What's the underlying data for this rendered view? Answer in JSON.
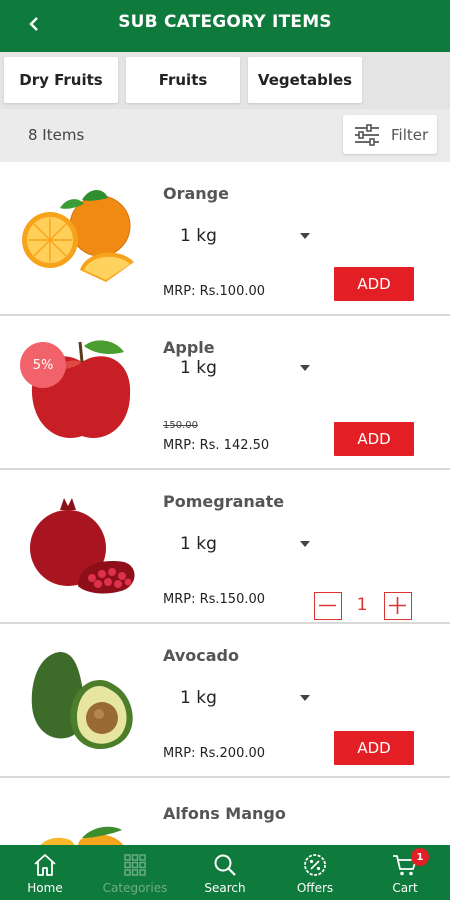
{
  "header": {
    "title": "SUB CATEGORY ITEMS",
    "back_icon": "chevron-left-icon"
  },
  "tabs": [
    {
      "label": "Dry Fruits"
    },
    {
      "label": "Fruits"
    },
    {
      "label": "Vegetables"
    }
  ],
  "listing": {
    "count_label": "8 Items",
    "filter_label": "Filter",
    "filter_icon": "sliders-icon"
  },
  "products": [
    {
      "name": "Orange",
      "quantity": "1 kg",
      "mrp": "MRP: Rs.100.00",
      "action": "ADD",
      "image": "orange-image"
    },
    {
      "name": "Apple",
      "quantity": "1 kg",
      "discount": "5%",
      "old_price": "150.00",
      "mrp": "MRP: Rs. 142.50",
      "action": "ADD",
      "image": "apple-image"
    },
    {
      "name": "Pomegranate",
      "quantity": "1 kg",
      "mrp": "MRP: Rs.150.00",
      "cart_qty": "1",
      "image": "pomegranate-image"
    },
    {
      "name": "Avocado",
      "quantity": "1 kg",
      "mrp": "MRP: Rs.200.00",
      "action": "ADD",
      "image": "avocado-image"
    },
    {
      "name": "Alfons Mango",
      "image": "mango-image"
    }
  ],
  "bottom_nav": [
    {
      "label": "Home",
      "icon": "home-icon"
    },
    {
      "label": "Categories",
      "icon": "grid-icon"
    },
    {
      "label": "Search",
      "icon": "search-icon"
    },
    {
      "label": "Offers",
      "icon": "offers-icon"
    },
    {
      "label": "Cart",
      "icon": "cart-icon",
      "badge": "1"
    }
  ],
  "colors": {
    "brand_green": "#0e7a3b",
    "accent_red": "#e31e24",
    "badge_pink": "#f2626b"
  }
}
